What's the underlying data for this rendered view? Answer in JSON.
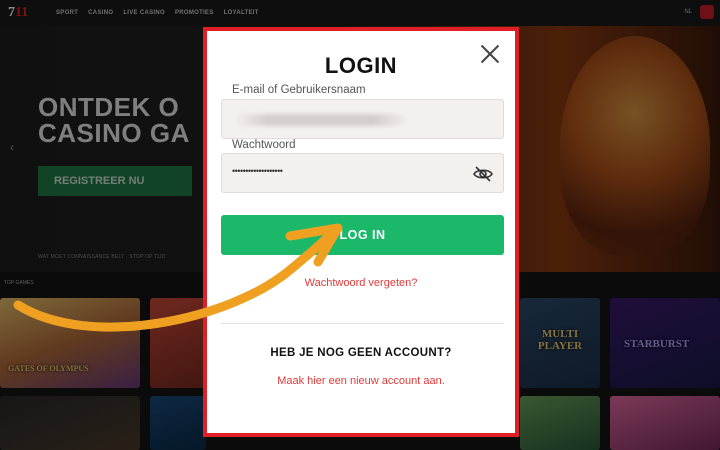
{
  "nav": {
    "links": [
      "SPORT",
      "CASINO",
      "LIVE CASINO",
      "PROMOTIES",
      "LOYALTEIT"
    ],
    "lang": "NL"
  },
  "hero": {
    "title_line1": "ONTDEK O",
    "title_line2": "CASINO GA",
    "register_button": "REGISTREER NU",
    "subtitle": "WAT MOET CONNAISSANCE BELT · STOP OP TIJD"
  },
  "games": {
    "label": "TOP GAMES",
    "tiles": [
      "GATES OF OLYMPUS",
      "MULTI PLAYER",
      "STARBURST"
    ]
  },
  "modal": {
    "title": "LOGIN",
    "email_label": "E-mail of Gebruikersnaam",
    "password_label": "Wachtwoord",
    "password_mask": "•••••••••••••••••••",
    "login_button": "LOG IN",
    "forgot_link": "Wachtwoord vergeten?",
    "no_account_heading": "HEB JE NOG GEEN ACCOUNT?",
    "register_link": "Maak hier een nieuw account aan."
  },
  "colors": {
    "modal_border": "#e01f26",
    "login_button": "#1bb86a",
    "link": "#e03a3a",
    "annotation_arrow": "#f0a020"
  }
}
